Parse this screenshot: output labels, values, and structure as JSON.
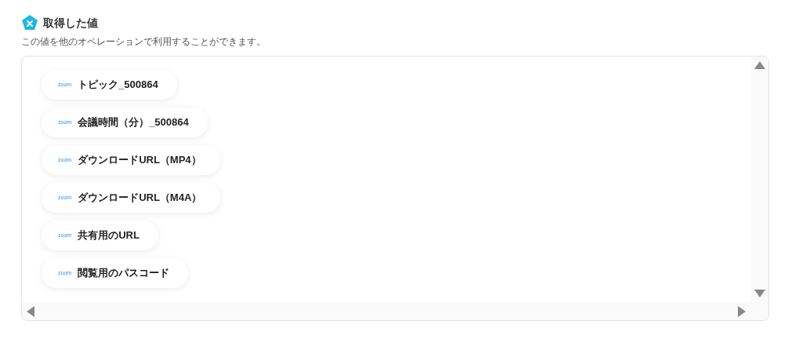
{
  "section": {
    "title": "取得した値",
    "description": "この値を他のオペレーションで利用することができます。"
  },
  "values": [
    {
      "source": "zoom",
      "label": "トピック_500864"
    },
    {
      "source": "zoom",
      "label": "会議時間（分）_500864"
    },
    {
      "source": "zoom",
      "label": "ダウンロードURL（MP4）"
    },
    {
      "source": "zoom",
      "label": "ダウンロードURL（M4A）"
    },
    {
      "source": "zoom",
      "label": "共有用のURL"
    },
    {
      "source": "zoom",
      "label": "閲覧用のパスコード"
    }
  ]
}
